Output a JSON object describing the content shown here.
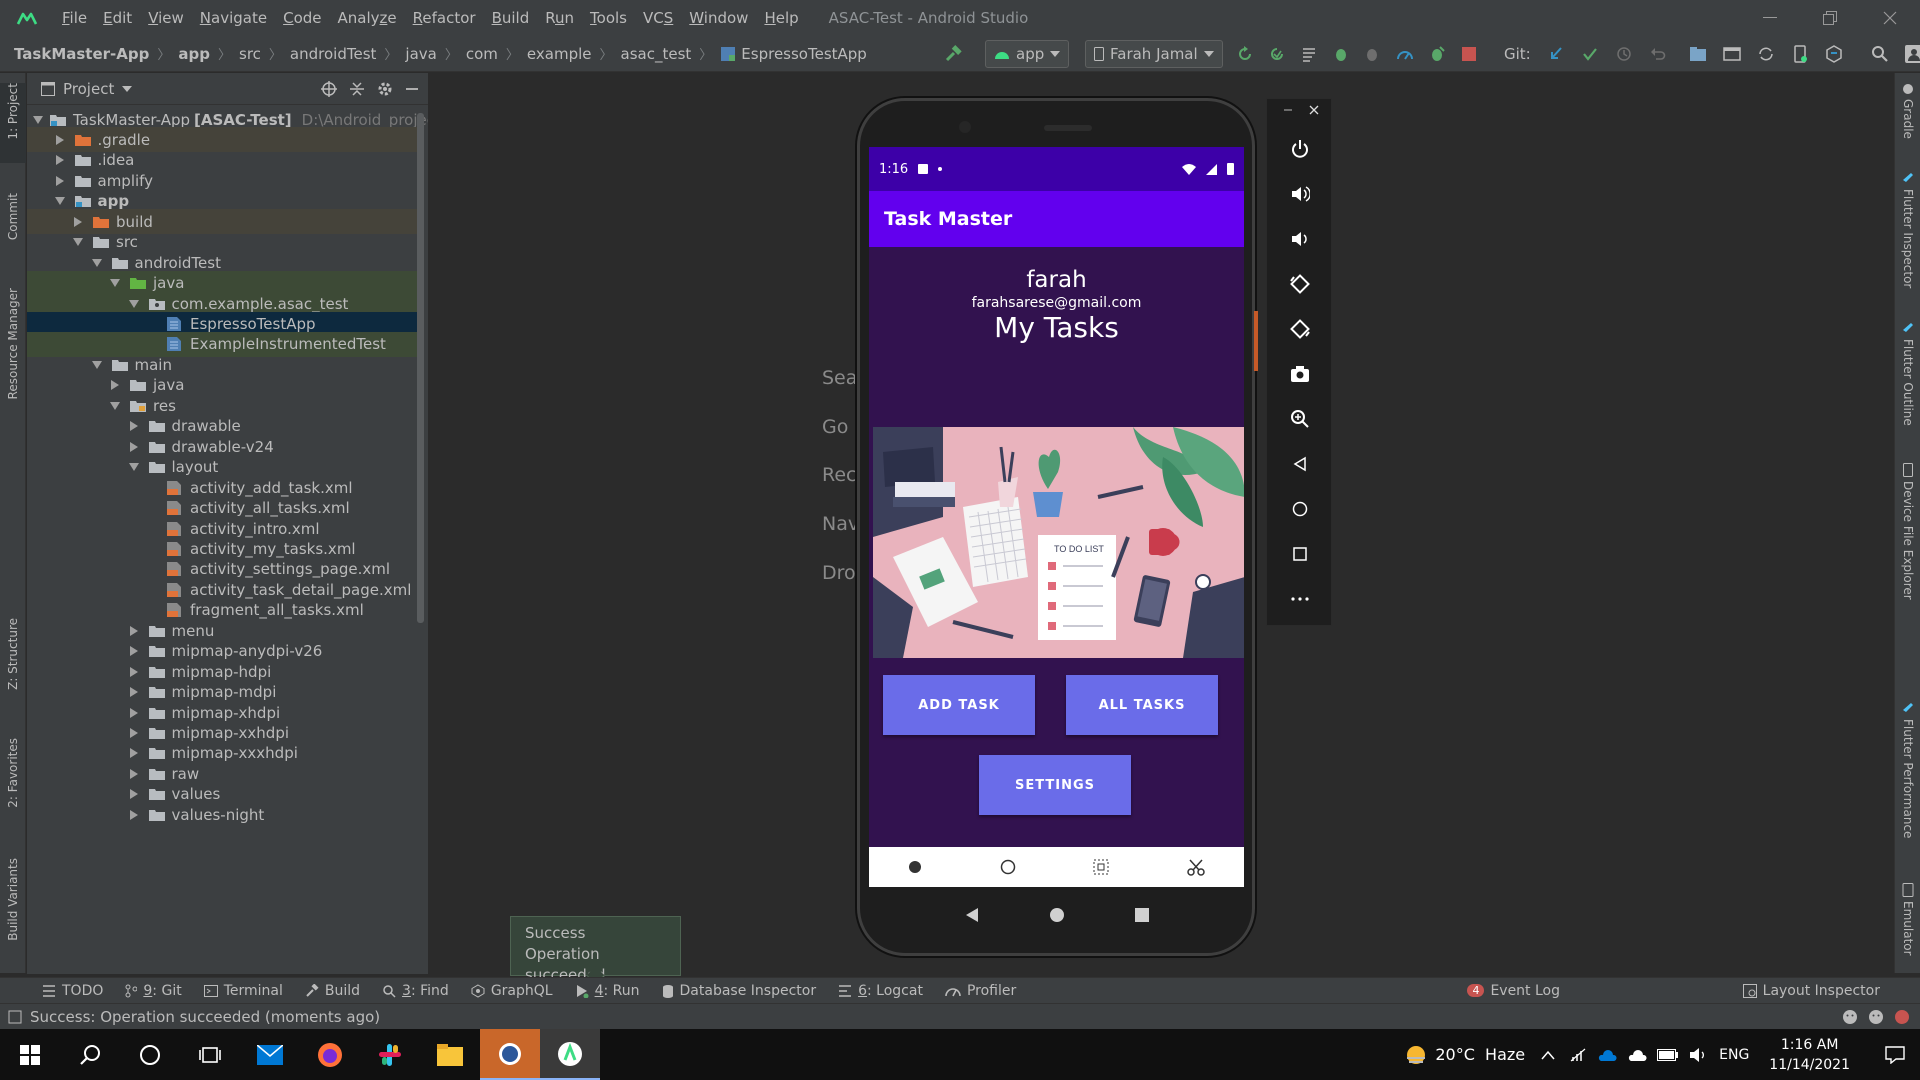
{
  "window": {
    "title": "ASAC-Test - Android Studio"
  },
  "menu": [
    {
      "pre": "",
      "u": "F",
      "post": "ile"
    },
    {
      "pre": "",
      "u": "E",
      "post": "dit"
    },
    {
      "pre": "",
      "u": "V",
      "post": "iew"
    },
    {
      "pre": "",
      "u": "N",
      "post": "avigate"
    },
    {
      "pre": "",
      "u": "C",
      "post": "ode"
    },
    {
      "pre": "Analy",
      "u": "z",
      "post": "e"
    },
    {
      "pre": "",
      "u": "R",
      "post": "efactor"
    },
    {
      "pre": "",
      "u": "B",
      "post": "uild"
    },
    {
      "pre": "R",
      "u": "u",
      "post": "n"
    },
    {
      "pre": "",
      "u": "T",
      "post": "ools"
    },
    {
      "pre": "VC",
      "u": "S",
      "post": ""
    },
    {
      "pre": "",
      "u": "W",
      "post": "indow"
    },
    {
      "pre": "",
      "u": "H",
      "post": "elp"
    }
  ],
  "breadcrumb": [
    "TaskMaster-App",
    "app",
    "src",
    "androidTest",
    "java",
    "com",
    "example",
    "asac_test",
    "EspressoTestApp"
  ],
  "toolbar": {
    "run_config": "app",
    "device": "Farah Jamal",
    "git_label": "Git:"
  },
  "project_panel": {
    "title": "Project",
    "tree": [
      {
        "label": "TaskMaster-App",
        "bold_suffix": "[ASAC-Test]",
        "path": "D:\\Android_projects\\t",
        "level": 0,
        "open": true,
        "icon": "module",
        "style": ""
      },
      {
        "label": ".gradle",
        "level": 1,
        "open": false,
        "icon": "folder-orange",
        "style": "brown"
      },
      {
        "label": ".idea",
        "level": 1,
        "open": false,
        "icon": "folder",
        "style": ""
      },
      {
        "label": "amplify",
        "level": 1,
        "open": false,
        "icon": "folder",
        "style": ""
      },
      {
        "label": "app",
        "level": 1,
        "open": true,
        "icon": "module",
        "style": "",
        "bold": true
      },
      {
        "label": "build",
        "level": 2,
        "open": false,
        "icon": "folder-orange",
        "style": "brown"
      },
      {
        "label": "src",
        "level": 2,
        "open": true,
        "icon": "folder",
        "style": ""
      },
      {
        "label": "androidTest",
        "level": 3,
        "open": true,
        "icon": "folder",
        "style": ""
      },
      {
        "label": "java",
        "level": 4,
        "open": true,
        "icon": "folder-green",
        "style": "green"
      },
      {
        "label": "com.example.asac_test",
        "level": 5,
        "open": true,
        "icon": "package",
        "style": "green"
      },
      {
        "label": "EspressoTestApp",
        "level": 6,
        "open": null,
        "icon": "class",
        "style": "sel"
      },
      {
        "label": "ExampleInstrumentedTest",
        "level": 6,
        "open": null,
        "icon": "class",
        "style": "green"
      },
      {
        "label": "main",
        "level": 3,
        "open": true,
        "icon": "folder",
        "style": ""
      },
      {
        "label": "java",
        "level": 4,
        "open": false,
        "icon": "folder",
        "style": ""
      },
      {
        "label": "res",
        "level": 4,
        "open": true,
        "icon": "folder-res",
        "style": ""
      },
      {
        "label": "drawable",
        "level": 5,
        "open": false,
        "icon": "folder",
        "style": ""
      },
      {
        "label": "drawable-v24",
        "level": 5,
        "open": false,
        "icon": "folder",
        "style": ""
      },
      {
        "label": "layout",
        "level": 5,
        "open": true,
        "icon": "folder",
        "style": ""
      },
      {
        "label": "activity_add_task.xml",
        "level": 6,
        "open": null,
        "icon": "xml",
        "style": ""
      },
      {
        "label": "activity_all_tasks.xml",
        "level": 6,
        "open": null,
        "icon": "xml",
        "style": ""
      },
      {
        "label": "activity_intro.xml",
        "level": 6,
        "open": null,
        "icon": "xml",
        "style": ""
      },
      {
        "label": "activity_my_tasks.xml",
        "level": 6,
        "open": null,
        "icon": "xml",
        "style": ""
      },
      {
        "label": "activity_settings_page.xml",
        "level": 6,
        "open": null,
        "icon": "xml",
        "style": ""
      },
      {
        "label": "activity_task_detail_page.xml",
        "level": 6,
        "open": null,
        "icon": "xml",
        "style": ""
      },
      {
        "label": "fragment_all_tasks.xml",
        "level": 6,
        "open": null,
        "icon": "xml",
        "style": ""
      },
      {
        "label": "menu",
        "level": 5,
        "open": false,
        "icon": "folder",
        "style": ""
      },
      {
        "label": "mipmap-anydpi-v26",
        "level": 5,
        "open": false,
        "icon": "folder",
        "style": ""
      },
      {
        "label": "mipmap-hdpi",
        "level": 5,
        "open": false,
        "icon": "folder",
        "style": ""
      },
      {
        "label": "mipmap-mdpi",
        "level": 5,
        "open": false,
        "icon": "folder",
        "style": ""
      },
      {
        "label": "mipmap-xhdpi",
        "level": 5,
        "open": false,
        "icon": "folder",
        "style": ""
      },
      {
        "label": "mipmap-xxhdpi",
        "level": 5,
        "open": false,
        "icon": "folder",
        "style": ""
      },
      {
        "label": "mipmap-xxxhdpi",
        "level": 5,
        "open": false,
        "icon": "folder",
        "style": ""
      },
      {
        "label": "raw",
        "level": 5,
        "open": false,
        "icon": "folder",
        "style": ""
      },
      {
        "label": "values",
        "level": 5,
        "open": false,
        "icon": "folder",
        "style": ""
      },
      {
        "label": "values-night",
        "level": 5,
        "open": false,
        "icon": "folder",
        "style": ""
      }
    ]
  },
  "left_tabs": [
    "1: Project",
    "Commit",
    "Resource Manager",
    "Z: Structure",
    "2: Favorites",
    "Build Variants"
  ],
  "right_tabs": [
    "Gradle",
    "Flutter Inspector",
    "Flutter Outline",
    "Device File Explorer",
    "Flutter Performance",
    "Emulator"
  ],
  "editor_hints": [
    "Sea",
    "Go",
    "Rec",
    "Nav",
    "Dro"
  ],
  "phone": {
    "time": "1:16",
    "app_title": "Task Master",
    "username": "farah",
    "email": "farahsarese@gmail.com",
    "heading": "My Tasks",
    "illustration_text": "TO DO LIST",
    "buttons": {
      "add": "ADD TASK",
      "all": "ALL TASKS",
      "settings": "SETTINGS"
    }
  },
  "toast": {
    "title": "Success",
    "message": "Operation succeeded"
  },
  "bottom_tabs": [
    {
      "icon": "list-icon",
      "pre": "",
      "u": "",
      "post": "TODO"
    },
    {
      "icon": "git-icon",
      "pre": "",
      "u": "9",
      "post": ": Git"
    },
    {
      "icon": "terminal-icon",
      "pre": "",
      "u": "",
      "post": "Terminal"
    },
    {
      "icon": "hammer-icon",
      "pre": "",
      "u": "",
      "post": "Build"
    },
    {
      "icon": "search-icon",
      "pre": "",
      "u": "3",
      "post": ": Find"
    },
    {
      "icon": "graphql-icon",
      "pre": "",
      "u": "",
      "post": "GraphQL"
    },
    {
      "icon": "run-icon",
      "pre": "",
      "u": "4",
      "post": ": Run"
    },
    {
      "icon": "database-icon",
      "pre": "",
      "u": "",
      "post": "Database Inspector"
    },
    {
      "icon": "logcat-icon",
      "pre": "",
      "u": "6",
      "post": ": Logcat"
    },
    {
      "icon": "profiler-icon",
      "pre": "",
      "u": "",
      "post": "Profiler"
    }
  ],
  "event_log": {
    "count": "4",
    "label": "Event Log"
  },
  "layout_inspector": "Layout Inspector",
  "status_message": "Success: Operation succeeded (moments ago)",
  "taskbar": {
    "weather": "20°C  Haze",
    "lang": "ENG",
    "time": "1:16 AM",
    "date": "11/14/2021"
  }
}
